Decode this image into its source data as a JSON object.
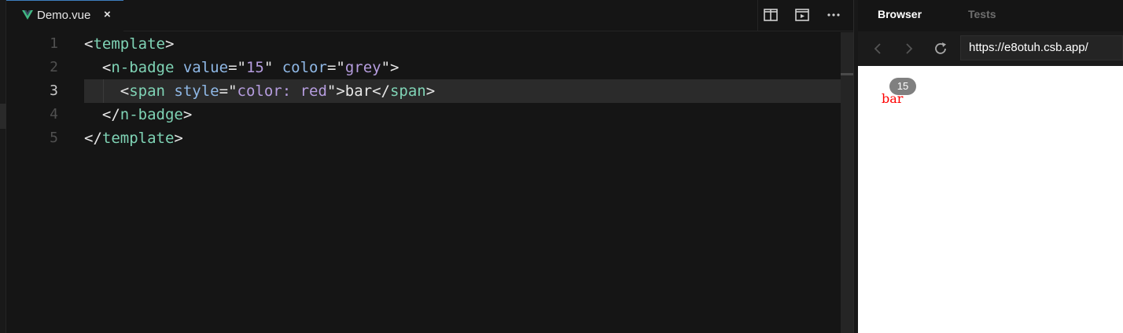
{
  "editor": {
    "tab": {
      "label": "Demo.vue",
      "close": "×"
    },
    "lines": [
      {
        "num": "1",
        "tokens": [
          [
            "p",
            "<"
          ],
          [
            "t",
            "template"
          ],
          [
            "p",
            ">"
          ]
        ]
      },
      {
        "num": "2",
        "tokens": [
          [
            "p",
            "  <"
          ],
          [
            "t",
            "n-badge"
          ],
          [
            "p",
            " "
          ],
          [
            "a",
            "value"
          ],
          [
            "p",
            "=\""
          ],
          [
            "s",
            "15"
          ],
          [
            "p",
            "\" "
          ],
          [
            "a",
            "color"
          ],
          [
            "p",
            "=\""
          ],
          [
            "s",
            "grey"
          ],
          [
            "p",
            "\">"
          ]
        ]
      },
      {
        "num": "3",
        "tokens": [
          [
            "p",
            "    <"
          ],
          [
            "t",
            "span"
          ],
          [
            "p",
            " "
          ],
          [
            "a",
            "style"
          ],
          [
            "p",
            "=\""
          ],
          [
            "s",
            "color: red"
          ],
          [
            "p",
            "\">bar</"
          ],
          [
            "t",
            "span"
          ],
          [
            "p",
            ">"
          ]
        ]
      },
      {
        "num": "4",
        "tokens": [
          [
            "p",
            "  </"
          ],
          [
            "t",
            "n-badge"
          ],
          [
            "p",
            ">"
          ]
        ]
      },
      {
        "num": "5",
        "tokens": [
          [
            "p",
            "</"
          ],
          [
            "t",
            "template"
          ],
          [
            "p",
            ">"
          ]
        ]
      }
    ],
    "active_line": 3,
    "tab_actions": [
      "split-editor-icon",
      "preview-icon",
      "more-icon"
    ]
  },
  "panel": {
    "tabs": {
      "browser": "Browser",
      "tests": "Tests"
    },
    "url": "https://e8otuh.csb.app/",
    "preview": {
      "text": "bar",
      "badge_value": "15"
    }
  },
  "colors": {
    "tag": "#7fd3b5",
    "attr": "#8fb8e6",
    "string": "#b69ddf",
    "badge_bg": "#808080",
    "preview_text": "#ff0000"
  }
}
